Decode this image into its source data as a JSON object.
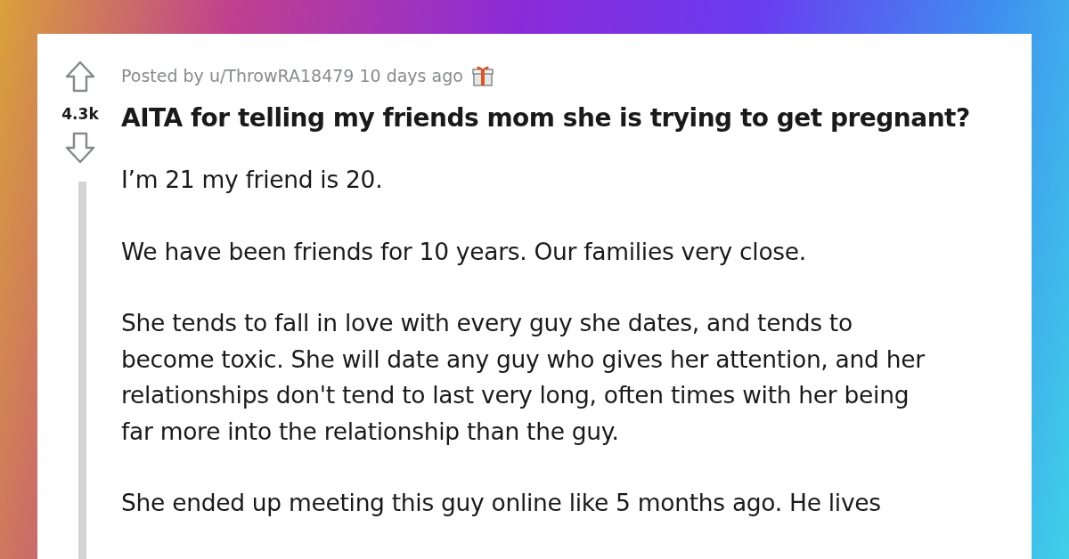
{
  "post": {
    "votes": "4.3k",
    "meta": "Posted by u/ThrowRA18479 10 days ago",
    "title": "AITA for telling my friends mom she is trying to get pregnant?",
    "paragraphs": [
      "I’m 21 my friend is 20.",
      "We have been friends for 10 years. Our families very close.",
      "She tends to fall in love with every guy she dates, and tends to become toxic. She will date any guy who gives her attention, and her relationships don't tend to last very long, often times with her being far more into the relationship than the guy.",
      "She ended up meeting this guy online like 5 months ago. He lives"
    ]
  }
}
